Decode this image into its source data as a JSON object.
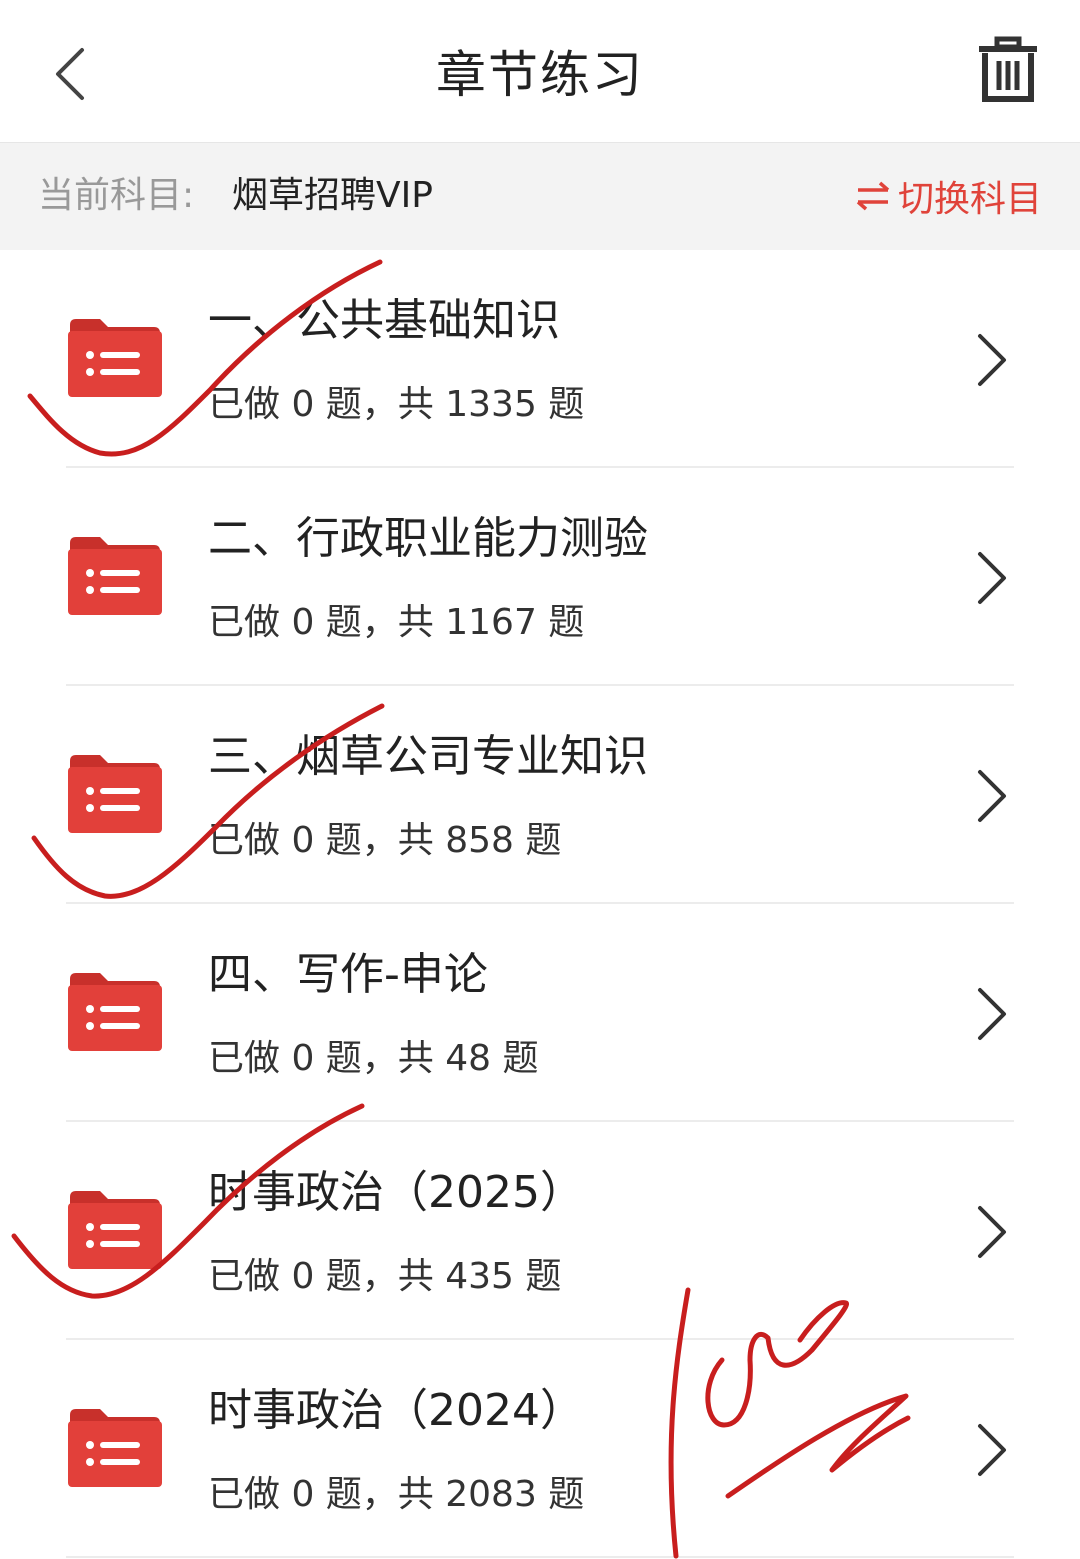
{
  "header": {
    "title": "章节练习",
    "back_icon": "back-chevron-icon",
    "trash_icon": "trash-icon"
  },
  "subject": {
    "label": "当前科目:",
    "value": "烟草招聘VIP",
    "switch_label": "切换科目",
    "switch_icon": "swap-arrows-icon"
  },
  "colors": {
    "accent": "#e0433a",
    "folder": "#e2403a",
    "ink": "#c81e1e"
  },
  "chapters": [
    {
      "title": "一、公共基础知识",
      "progress": "已做 0 题，共 1335 题"
    },
    {
      "title": "二、行政职业能力测验",
      "progress": "已做 0 题，共 1167 题"
    },
    {
      "title": "三、烟草公司专业知识",
      "progress": "已做 0 题，共 858 题"
    },
    {
      "title": "四、写作-申论",
      "progress": "已做 0 题，共 48 题"
    },
    {
      "title": "时事政治（2025）",
      "progress": "已做 0 题，共 435 题"
    },
    {
      "title": "时事政治（2024）",
      "progress": "已做 0 题，共 2083 题"
    }
  ]
}
